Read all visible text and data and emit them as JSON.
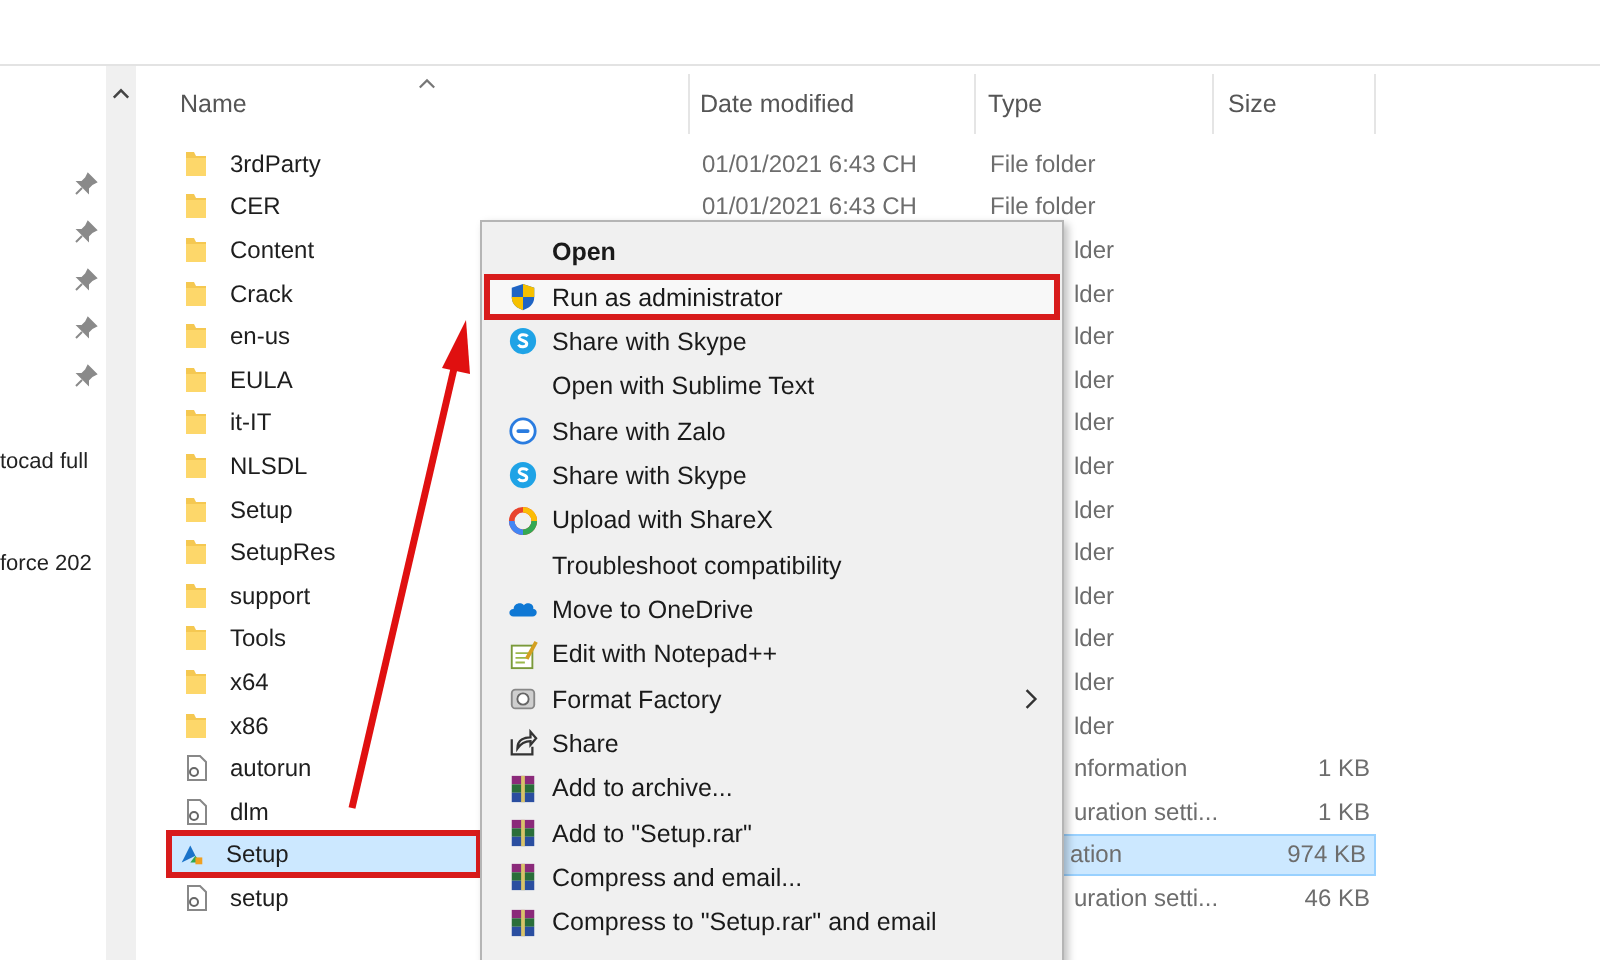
{
  "nav_pane": {
    "items": [
      "tocad full",
      "force 202"
    ]
  },
  "columns": [
    {
      "label": "Name",
      "sorted": true
    },
    {
      "label": "Date modified",
      "sorted": false
    },
    {
      "label": "Type",
      "sorted": false
    },
    {
      "label": "Size",
      "sorted": false
    }
  ],
  "files": [
    {
      "name": "3rdParty",
      "kind": "folder",
      "date": "01/01/2021 6:43 CH",
      "type": "File folder",
      "type_partial": false,
      "selected": false,
      "annotated": false
    },
    {
      "name": "CER",
      "kind": "folder",
      "date": "01/01/2021 6:43 CH",
      "type": "File folder",
      "type_partial": false,
      "selected": false,
      "annotated": false
    },
    {
      "name": "Content",
      "kind": "folder",
      "type": "lder",
      "type_partial": true,
      "selected": false,
      "annotated": false
    },
    {
      "name": "Crack",
      "kind": "folder",
      "type": "lder",
      "type_partial": true,
      "selected": false,
      "annotated": false
    },
    {
      "name": "en-us",
      "kind": "folder",
      "type": "lder",
      "type_partial": true,
      "selected": false,
      "annotated": false
    },
    {
      "name": "EULA",
      "kind": "folder",
      "type": "lder",
      "type_partial": true,
      "selected": false,
      "annotated": false
    },
    {
      "name": "it-IT",
      "kind": "folder",
      "type": "lder",
      "type_partial": true,
      "selected": false,
      "annotated": false
    },
    {
      "name": "NLSDL",
      "kind": "folder",
      "type": "lder",
      "type_partial": true,
      "selected": false,
      "annotated": false
    },
    {
      "name": "Setup",
      "kind": "folder",
      "type": "lder",
      "type_partial": true,
      "selected": false,
      "annotated": false
    },
    {
      "name": "SetupRes",
      "kind": "folder",
      "type": "lder",
      "type_partial": true,
      "selected": false,
      "annotated": false
    },
    {
      "name": "support",
      "kind": "folder",
      "type": "lder",
      "type_partial": true,
      "selected": false,
      "annotated": false
    },
    {
      "name": "Tools",
      "kind": "folder",
      "type": "lder",
      "type_partial": true,
      "selected": false,
      "annotated": false
    },
    {
      "name": "x64",
      "kind": "folder",
      "type": "lder",
      "type_partial": true,
      "selected": false,
      "annotated": false
    },
    {
      "name": "x86",
      "kind": "folder",
      "type": "lder",
      "type_partial": true,
      "selected": false,
      "annotated": false
    },
    {
      "name": "autorun",
      "kind": "settings",
      "type": "nformation",
      "type_partial": true,
      "size": "1 KB",
      "selected": false,
      "annotated": false
    },
    {
      "name": "dlm",
      "kind": "settings",
      "type": "uration setti...",
      "type_partial": true,
      "size": "1 KB",
      "selected": false,
      "annotated": false
    },
    {
      "name": "Setup",
      "kind": "app",
      "type": "ation",
      "type_partial": true,
      "size": "974 KB",
      "selected": true,
      "annotated": true
    },
    {
      "name": "setup",
      "kind": "settings",
      "type": "uration setti...",
      "type_partial": true,
      "size": "46 KB",
      "selected": false,
      "annotated": false
    }
  ],
  "context_menu": [
    {
      "label": "Open",
      "kind": "none",
      "default": true,
      "submenu": false,
      "annotated": false
    },
    {
      "label": "Run as administrator",
      "kind": "shield",
      "default": false,
      "submenu": false,
      "annotated": true
    },
    {
      "label": "Share with Skype",
      "kind": "skype",
      "default": false,
      "submenu": false,
      "annotated": false
    },
    {
      "label": "Open with Sublime Text",
      "kind": "none",
      "default": false,
      "submenu": false,
      "annotated": false
    },
    {
      "label": "Share with Zalo",
      "kind": "zalo",
      "default": false,
      "submenu": false,
      "annotated": false
    },
    {
      "label": "Share with Skype",
      "kind": "skype",
      "default": false,
      "submenu": false,
      "annotated": false
    },
    {
      "label": "Upload with ShareX",
      "kind": "sharex",
      "default": false,
      "submenu": false,
      "annotated": false
    },
    {
      "label": "Troubleshoot compatibility",
      "kind": "none",
      "default": false,
      "submenu": false,
      "annotated": false
    },
    {
      "label": "Move to OneDrive",
      "kind": "cloud",
      "default": false,
      "submenu": false,
      "annotated": false
    },
    {
      "label": "Edit with Notepad++",
      "kind": "notepad",
      "default": false,
      "submenu": false,
      "annotated": false
    },
    {
      "label": "Format Factory",
      "kind": "factory",
      "default": false,
      "submenu": true,
      "annotated": false
    },
    {
      "label": "Share",
      "kind": "share",
      "default": false,
      "submenu": false,
      "annotated": false
    },
    {
      "label": "Add to archive...",
      "kind": "archive",
      "default": false,
      "submenu": false,
      "annotated": false
    },
    {
      "label": "Add to \"Setup.rar\"",
      "kind": "archive",
      "default": false,
      "submenu": false,
      "annotated": false
    },
    {
      "label": "Compress and email...",
      "kind": "archive",
      "default": false,
      "submenu": false,
      "annotated": false
    },
    {
      "label": "Compress to \"Setup.rar\" and email",
      "kind": "archive",
      "default": false,
      "submenu": false,
      "annotated": false
    }
  ]
}
